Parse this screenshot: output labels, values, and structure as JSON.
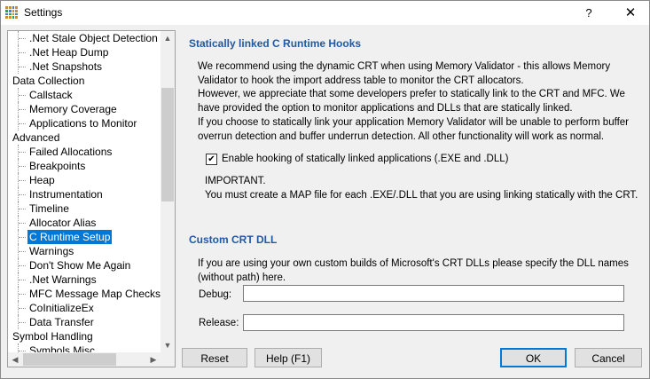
{
  "window": {
    "title": "Settings",
    "help_glyph": "?",
    "close_glyph": "✕"
  },
  "tree": {
    "items": [
      {
        "label": ".Net Stale Object Detection",
        "level": 1
      },
      {
        "label": ".Net Heap Dump",
        "level": 1
      },
      {
        "label": ".Net Snapshots",
        "level": 1
      },
      {
        "label": "Data Collection",
        "level": 0
      },
      {
        "label": "Callstack",
        "level": 1
      },
      {
        "label": "Memory Coverage",
        "level": 1
      },
      {
        "label": "Applications to Monitor",
        "level": 1
      },
      {
        "label": "Advanced",
        "level": 0
      },
      {
        "label": "Failed Allocations",
        "level": 1
      },
      {
        "label": "Breakpoints",
        "level": 1
      },
      {
        "label": "Heap",
        "level": 1
      },
      {
        "label": "Instrumentation",
        "level": 1
      },
      {
        "label": "Timeline",
        "level": 1
      },
      {
        "label": "Allocator Alias",
        "level": 1
      },
      {
        "label": "C Runtime Setup",
        "level": 1,
        "selected": true
      },
      {
        "label": "Warnings",
        "level": 1
      },
      {
        "label": "Don't Show Me Again",
        "level": 1
      },
      {
        "label": ".Net Warnings",
        "level": 1
      },
      {
        "label": "MFC Message Map Checks",
        "level": 1
      },
      {
        "label": "CoInitializeEx",
        "level": 1
      },
      {
        "label": "Data Transfer",
        "level": 1
      },
      {
        "label": "Symbol Handling",
        "level": 0
      },
      {
        "label": "Symbols Misc",
        "level": 1
      }
    ]
  },
  "hooks": {
    "title": "Statically linked C Runtime Hooks",
    "para1": "We recommend using the dynamic CRT when using Memory Validator - this allows Memory Validator to hook the import address table to monitor the CRT allocators.",
    "para2": "However, we appreciate that some developers prefer to statically link to the CRT and MFC. We have provided the option to monitor applications and DLLs that are statically linked.",
    "para3": "If you choose to statically link your application Memory Validator will be unable to perform buffer overrun detection and buffer underrun detection. All other functionality will work as normal.",
    "checkbox_label": "Enable hooking of statically linked applications (.EXE and .DLL)",
    "checkbox_checked": true,
    "important_heading": "IMPORTANT.",
    "important_text": "You must create a MAP file for each .EXE/.DLL that you are using linking statically with the CRT."
  },
  "custom_crt": {
    "title": "Custom CRT DLL",
    "description": "If you are using your own custom builds of Microsoft's CRT DLLs please specify the DLL names (without path) here.",
    "debug_label": "Debug:",
    "debug_value": "",
    "release_label": "Release:",
    "release_value": ""
  },
  "buttons": {
    "reset": "Reset",
    "help": "Help (F1)",
    "ok": "OK",
    "cancel": "Cancel"
  },
  "colors": {
    "section_title": "#1f5aa6",
    "selection": "#0078d7"
  }
}
